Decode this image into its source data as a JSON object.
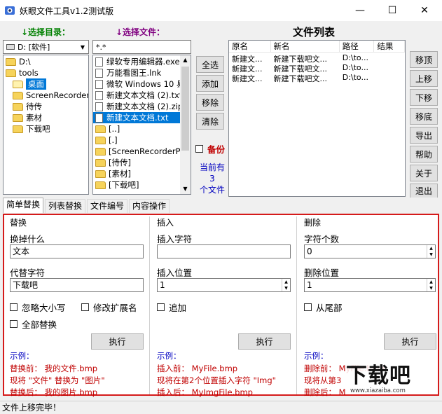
{
  "window": {
    "title": "妖眼文件工具v1.2测试版",
    "minimize": "—",
    "maximize": "☐",
    "close": "✕"
  },
  "labels": {
    "select_dir": "↓选择目录：",
    "select_file": "↓选择文件：",
    "file_list": "文件列表"
  },
  "drive_combo": {
    "value": "D: [软件]"
  },
  "filter_input": {
    "value": "*.*"
  },
  "tree": [
    {
      "label": "D:\\"
    },
    {
      "label": "tools"
    },
    {
      "label": "桌面",
      "selected": true
    },
    {
      "label": "ScreenRecorderPr"
    },
    {
      "label": "待传"
    },
    {
      "label": "素材"
    },
    {
      "label": "下载吧"
    }
  ],
  "files": [
    {
      "label": "绿软专用编辑器.exe",
      "type": "file"
    },
    {
      "label": "万能看图王.lnk",
      "type": "file"
    },
    {
      "label": "微软 Windows 10 易",
      "type": "file"
    },
    {
      "label": "新建文本文档 (2).txt",
      "type": "file"
    },
    {
      "label": "新建文本文档 (2).zip",
      "type": "file"
    },
    {
      "label": "新建文本文档.txt",
      "type": "file",
      "selected": true
    },
    {
      "label": "[..]",
      "type": "folder"
    },
    {
      "label": "[.]",
      "type": "folder"
    },
    {
      "label": "[ScreenRecorderProj",
      "type": "folder"
    },
    {
      "label": "[待传]",
      "type": "folder"
    },
    {
      "label": "[素材]",
      "type": "folder"
    },
    {
      "label": "[下载吧]",
      "type": "folder"
    }
  ],
  "mid_buttons": {
    "select_all": "全选",
    "add": "添加",
    "remove": "移除",
    "clear": "清除"
  },
  "backup": {
    "label": "备份",
    "checked": false
  },
  "current_count": {
    "line1": "当前有",
    "count": "3",
    "line3": "个文件"
  },
  "list": {
    "headers": [
      "原名",
      "新名",
      "路径",
      "结果"
    ],
    "rows": [
      [
        "新建文...",
        "新建下载吧文...",
        "D:\\to...",
        ""
      ],
      [
        "新建文...",
        "新建下载吧文...",
        "D:\\to...",
        ""
      ],
      [
        "新建文...",
        "新建下载吧文...",
        "D:\\to...",
        ""
      ]
    ]
  },
  "right_buttons": {
    "top": "移顶",
    "up": "上移",
    "down": "下移",
    "bottom": "移底",
    "export": "导出",
    "help": "帮助",
    "about": "关于",
    "exit": "退出"
  },
  "tabs": [
    "简单替换",
    "列表替换",
    "文件编号",
    "内容操作"
  ],
  "replace": {
    "title": "替换",
    "find_label": "换掉什么",
    "find_value": "文本",
    "replace_label": "代替字符",
    "replace_value": "下载吧",
    "ignore_case": "忽略大小写",
    "modify_ext": "修改扩展名",
    "replace_all": "全部替换",
    "exec": "执行",
    "example_title": "示例：",
    "ex1": "替换前：  我的文件.bmp",
    "ex2": "现将 \"文件\" 替换为 \"图片\"",
    "ex3": "替换后：  我的图片.bmp"
  },
  "insert": {
    "title": "插入",
    "chars_label": "插入字符",
    "chars_value": "",
    "pos_label": "插入位置",
    "pos_value": "1",
    "append": "追加",
    "exec": "执行",
    "example_title": "示例：",
    "ex1": "插入前：  MyFile.bmp",
    "ex2": "现将在第2个位置插入字符 \"Img\"",
    "ex3": "插入后：  MyImgFile.bmp"
  },
  "delete": {
    "title": "删除",
    "count_label": "字符个数",
    "count_value": "0",
    "pos_label": "删除位置",
    "pos_value": "1",
    "from_end": "从尾部",
    "exec": "执行",
    "example_title": "示例：",
    "ex1": "删除前：  MyFile.bmp",
    "ex2": "现将从第3",
    "ex3": "删除后：  M"
  },
  "watermark": {
    "text": "下载吧",
    "url": "www.xiazaiba.com"
  },
  "status": {
    "text": "文件上移完毕！"
  },
  "colors": {
    "selection": "#0078d7",
    "panel_border": "#d51a1a",
    "example_red": "#c00000",
    "example_blue": "#0000c0"
  }
}
